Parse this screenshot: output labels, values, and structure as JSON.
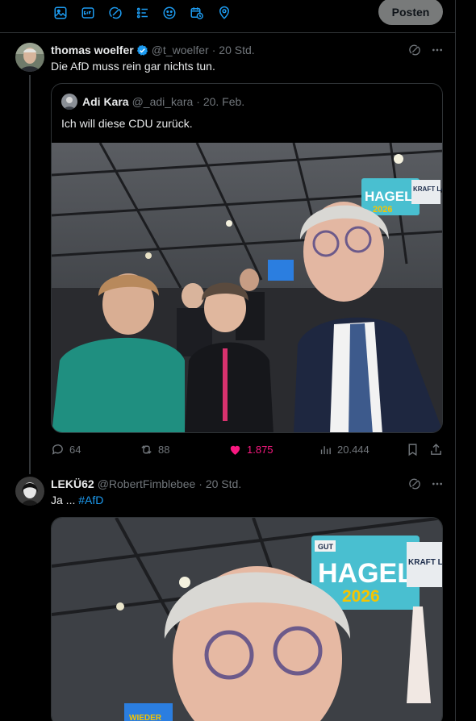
{
  "composer": {
    "tools": [
      "image-icon",
      "gif-icon",
      "grok-icon",
      "poll-icon",
      "emoji-icon",
      "schedule-icon",
      "location-icon"
    ],
    "post_label": "Posten"
  },
  "tweets": [
    {
      "name": "thomas woelfer",
      "verified": true,
      "handle": "@t_woelfer",
      "time": "· 20 Std.",
      "text": "Die AfD muss rein gar nichts tun.",
      "quote": {
        "name": "Adi Kara",
        "handle": "@_adi_kara",
        "time": "· 20. Feb.",
        "text": "Ich will diese CDU zurück.",
        "image": {
          "sign_line1": "HAGEL",
          "sign_line2": "2026",
          "sign_side": "KRAFT LAND"
        }
      },
      "stats": {
        "replies": "64",
        "reposts": "88",
        "likes": "1.875",
        "views": "20.444"
      }
    },
    {
      "name": "LEKÜ62",
      "handle": "@RobertFimblebee",
      "time": "· 20 Std.",
      "text_prefix": "Ja ... ",
      "hashtag": "#AfD",
      "image": {
        "sign_line1": "HAGEL",
        "sign_line2": "2026",
        "sign_badge": "GUT",
        "sign_side": "KRAFT LAND",
        "bottom_sign": "WIEDER"
      }
    }
  ],
  "colors": {
    "background": "#000000",
    "border": "#2f3336",
    "text": "#e7e9ea",
    "muted": "#71767b",
    "accent": "#1d9bf0",
    "like": "#f91880",
    "post_button": "#787a7a"
  }
}
